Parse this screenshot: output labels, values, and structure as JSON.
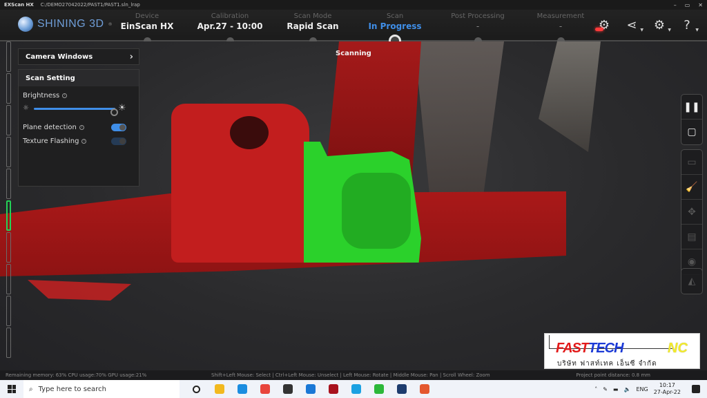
{
  "window": {
    "app_name": "EXScan HX",
    "path": "C:/DEMO27042022/PAST1/PAST1.sln_lrap",
    "minimize": "–",
    "maximize": "▭",
    "close": "✕"
  },
  "header": {
    "brand": "SHINING 3D",
    "steps": [
      {
        "label": "Device",
        "value": "EinScan HX",
        "state": "done"
      },
      {
        "label": "Calibration",
        "value": "Apr.27 - 10:00",
        "state": "done"
      },
      {
        "label": "Scan Mode",
        "value": "Rapid Scan",
        "state": "done"
      },
      {
        "label": "Scan",
        "value": "In Progress",
        "state": "active"
      },
      {
        "label": "Post Processing",
        "value": "-",
        "state": "pending"
      },
      {
        "label": "Measurement",
        "value": "-",
        "state": "pending"
      }
    ],
    "icons": [
      "record-icon",
      "share-icon",
      "settings-icon",
      "help-icon"
    ]
  },
  "viewport": {
    "status_label": "Scanning"
  },
  "distance_indicator": {
    "segments": 10,
    "active_segment": 5
  },
  "panel": {
    "camera_windows": "Camera Windows",
    "scan_setting": "Scan Setting",
    "brightness_label": "Brightness",
    "brightness_value_fraction": 0.98,
    "plane_detection_label": "Plane detection",
    "plane_detection_on": true,
    "texture_flashing_label": "Texture Flashing",
    "texture_flashing_on": false
  },
  "right_toolbar": {
    "group1": [
      {
        "name": "pause",
        "glyph": "❚❚",
        "enabled": true
      },
      {
        "name": "stop",
        "glyph": "▢",
        "enabled": true
      }
    ],
    "group2": [
      {
        "name": "window",
        "glyph": "▭",
        "enabled": false
      },
      {
        "name": "clean",
        "glyph": "🧹",
        "enabled": true
      },
      {
        "name": "puzzle",
        "glyph": "✥",
        "enabled": false
      },
      {
        "name": "save",
        "glyph": "▤",
        "enabled": false
      },
      {
        "name": "view",
        "glyph": "◉",
        "enabled": false
      }
    ],
    "group3": [
      {
        "name": "mesh",
        "glyph": "◭",
        "enabled": false
      }
    ]
  },
  "overlay_logo": {
    "fast": "FAST",
    "tech": "TECH",
    "nc": "NC",
    "thai": "บริษัท ฟาสท์เทค เอ็นซี จำกัด"
  },
  "status_bar": {
    "system": "Remaining memory: 63% CPU usage:70% GPU usage:21%",
    "hints": "Shift+Left Mouse: Select | Ctrl+Left Mouse: Unselect | Left Mouse: Rotate | Middle Mouse: Pan | Scroll Wheel: Zoom",
    "point_distance": "Project point distance: 0.8 mm"
  },
  "taskbar": {
    "search_placeholder": "Type here to search",
    "apps": [
      {
        "name": "cortana",
        "color": "#ffffff"
      },
      {
        "name": "file-explorer",
        "color": "#f2b91f"
      },
      {
        "name": "edge",
        "color": "#1b8de0"
      },
      {
        "name": "chrome",
        "color": "#e8453c"
      },
      {
        "name": "store",
        "color": "#333333"
      },
      {
        "name": "mail",
        "color": "#1a78d6"
      },
      {
        "name": "exscan",
        "color": "#a8121e"
      },
      {
        "name": "skype",
        "color": "#1ba1e2"
      },
      {
        "name": "line",
        "color": "#2cb83a"
      },
      {
        "name": "shining3d",
        "color": "#1d3c6e"
      },
      {
        "name": "office",
        "color": "#e4572e"
      }
    ],
    "language": "ENG",
    "time": "10:17",
    "date": "27-Apr-22"
  }
}
